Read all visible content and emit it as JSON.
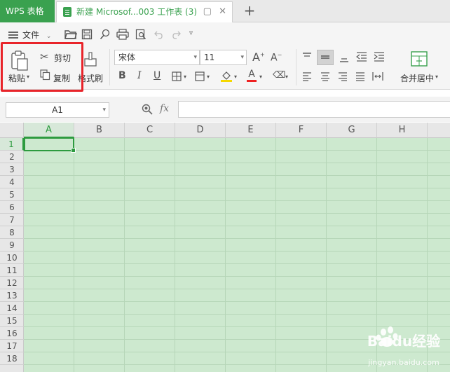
{
  "tabs": {
    "app_tab": "WPS 表格",
    "doc_tab": "新建 Microsof...003 工作表 (3)",
    "new_tab": "+"
  },
  "ribbon": {
    "file_menu": "文件",
    "paste": "粘贴",
    "cut": "剪切",
    "copy": "复制",
    "format_painter": "格式刷",
    "font_name": "宋体",
    "font_size": "11",
    "merge_center": "合并居中"
  },
  "formula_bar": {
    "name_box": "A1",
    "fx": "fx",
    "formula_value": ""
  },
  "grid": {
    "columns": [
      "A",
      "B",
      "C",
      "D",
      "E",
      "F",
      "G",
      "H"
    ],
    "rows": [
      "1",
      "2",
      "3",
      "4",
      "5",
      "6",
      "7",
      "8",
      "9",
      "10",
      "11",
      "12",
      "13",
      "14",
      "15",
      "16",
      "17",
      "18"
    ],
    "active_cell": "A1"
  },
  "watermark": {
    "brand": "Baidu经验",
    "url": "jingyan.baidu.com"
  },
  "colors": {
    "brand_green": "#3aa14f",
    "sheet_bg": "#cde9cf",
    "highlight_red": "#e8242a"
  }
}
